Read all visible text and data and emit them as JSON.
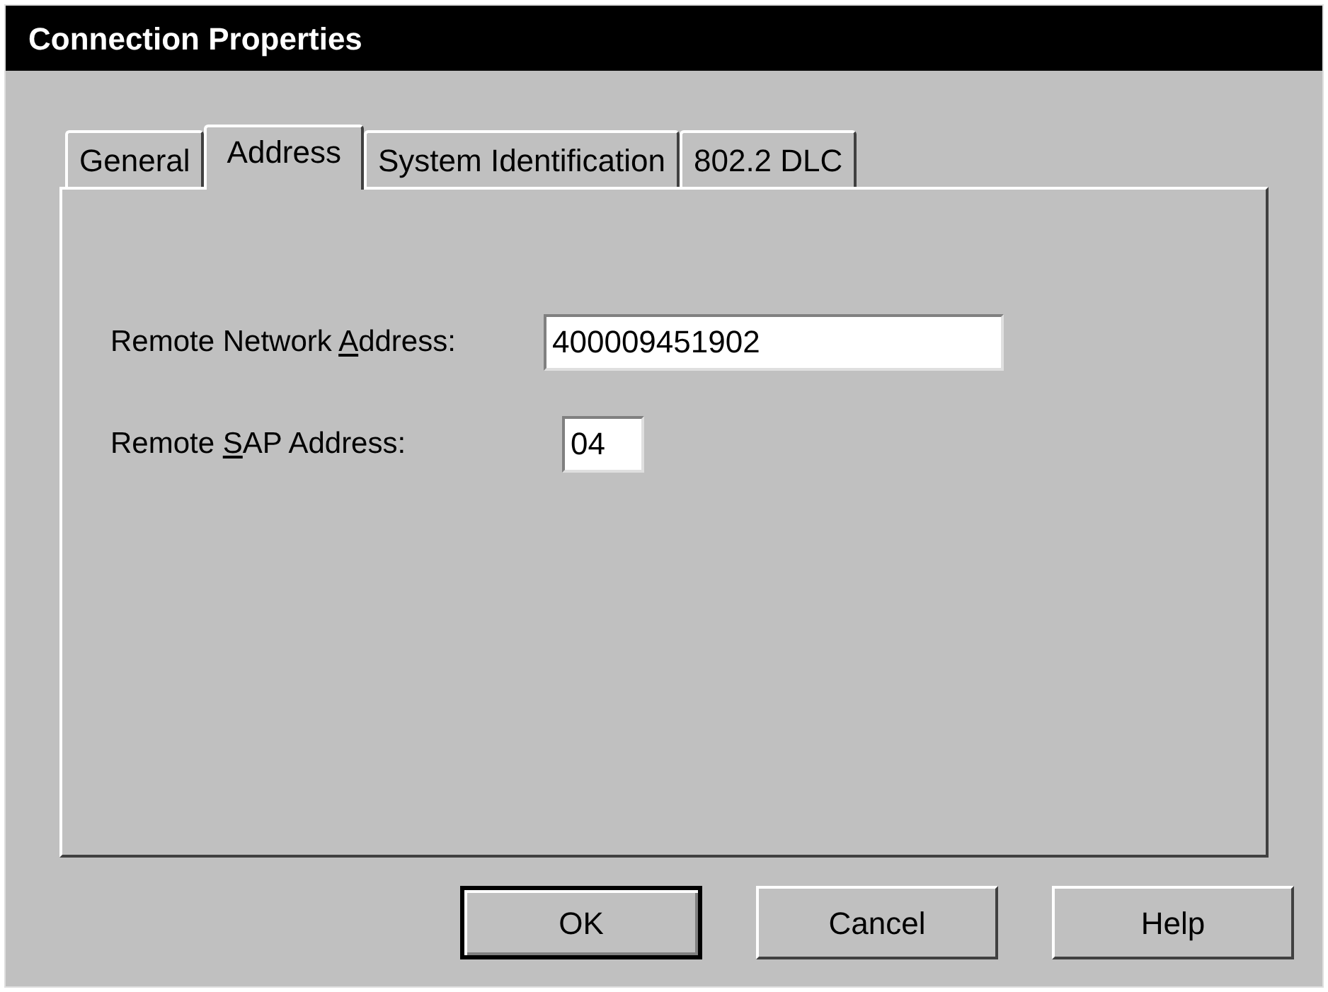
{
  "window": {
    "title": "Connection Properties"
  },
  "tabs": [
    {
      "label": "General",
      "selected": false
    },
    {
      "label": "Address",
      "selected": true
    },
    {
      "label": "System Identification",
      "selected": false
    },
    {
      "label": "802.2 DLC",
      "selected": false
    }
  ],
  "fields": [
    {
      "label_before": "Remote Network ",
      "accelerator": "A",
      "label_after": "ddress:",
      "value": "400009451902",
      "kind": "wide"
    },
    {
      "label_before": "Remote ",
      "accelerator": "S",
      "label_after": "AP Address:",
      "value": "04",
      "kind": "narrow"
    }
  ],
  "buttons": [
    {
      "label": "OK",
      "default": true
    },
    {
      "label": "Cancel",
      "default": false
    },
    {
      "label": "Help",
      "default": false
    }
  ]
}
